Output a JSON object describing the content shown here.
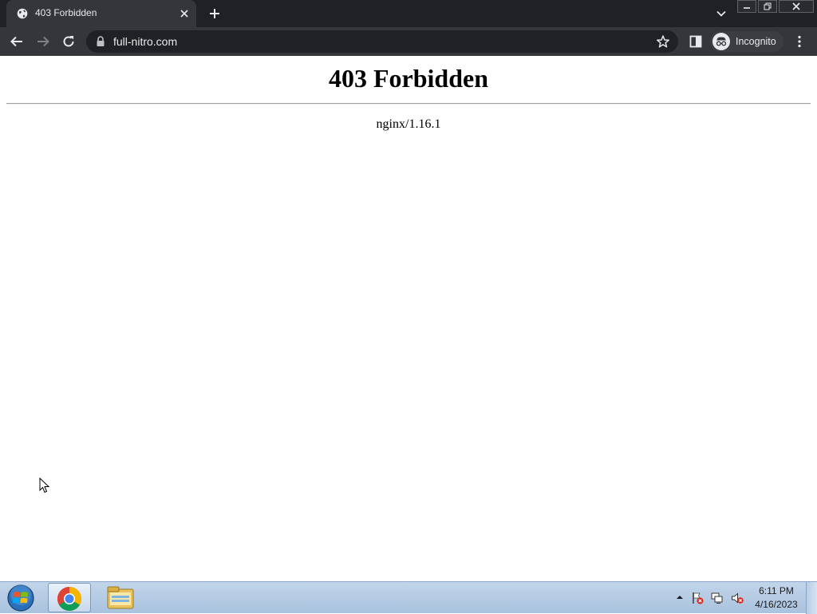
{
  "browser": {
    "tab": {
      "title": "403 Forbidden",
      "favicon": "globe-icon"
    },
    "omnibox": {
      "url": "full-nitro.com"
    },
    "profile": {
      "label": "Incognito"
    },
    "colors": {
      "frame": "#202124",
      "toolbar": "#35363a",
      "omnibox": "#202124",
      "text": "#e8eaed"
    }
  },
  "page": {
    "heading": "403 Forbidden",
    "server_signature": "nginx/1.16.1"
  },
  "taskbar": {
    "pinned": [
      "start-orb-icon",
      "chrome-icon",
      "file-explorer-icon"
    ],
    "tray_icons": [
      "show-hidden-icons-arrow",
      "action-center-flag-icon",
      "network-icon",
      "volume-muted-icon"
    ],
    "clock": {
      "time": "6:11 PM",
      "date": "4/16/2023"
    }
  }
}
